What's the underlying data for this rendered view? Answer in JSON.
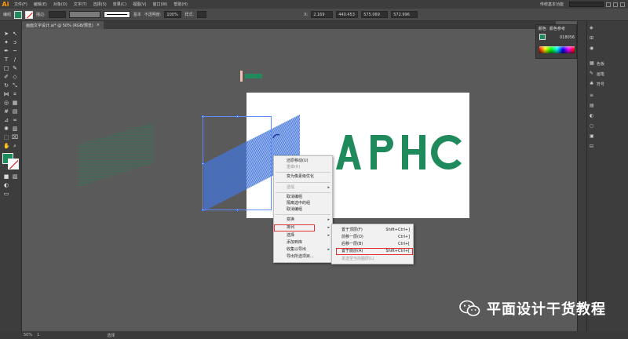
{
  "app": {
    "logo": "Ai"
  },
  "menu": [
    "文件(F)",
    "编辑(E)",
    "对象(O)",
    "文字(T)",
    "选择(S)",
    "效果(C)",
    "视图(V)",
    "窗口(W)",
    "帮助(H)"
  ],
  "workspace": "传统基本功能",
  "control": {
    "object_label": "编组",
    "opacity_label": "描边:",
    "stroke_style": "基本",
    "opacity_title": "不透明度:",
    "opacity_value": "100%",
    "style_label": "样式:",
    "x_value": "440.453",
    "y_value": "575.069",
    "w_value": "572.996",
    "ref_label": "X:",
    "mm_value": "2.169"
  },
  "document_tab": {
    "title": "画面文字设计.ai* @ 50% (RGB/预览)",
    "close": "×"
  },
  "status": {
    "zoom": "50%",
    "page": "1",
    "mode": "选择"
  },
  "color_panel": {
    "tab1": "颜色",
    "tab2": "颜色参考",
    "hex": "018056"
  },
  "dock": [
    {
      "icon": "swatch-icon",
      "label": "色板"
    },
    {
      "icon": "brush-icon",
      "label": "画笔"
    },
    {
      "icon": "symbol-icon",
      "label": "符号"
    }
  ],
  "artwork": {
    "letters": "APHC"
  },
  "context_menu": {
    "items": [
      {
        "label": "还原移动(U)",
        "disabled": false
      },
      {
        "label": "重做(R)",
        "disabled": true
      },
      {
        "label": "变为像素级优化",
        "disabled": false
      },
      {
        "label": "透视",
        "disabled": true,
        "submenu": true
      },
      {
        "label": "取消编组",
        "disabled": false
      },
      {
        "label": "隔离选中的组",
        "disabled": false
      },
      {
        "label": "取消编组",
        "disabled": false
      },
      {
        "label": "变换",
        "disabled": false,
        "submenu": true
      },
      {
        "label": "排列",
        "disabled": false,
        "submenu": true
      },
      {
        "label": "选择",
        "disabled": false,
        "submenu": true
      },
      {
        "label": "添加到库",
        "disabled": false
      },
      {
        "label": "收集以导出",
        "disabled": false,
        "submenu": true
      },
      {
        "label": "导出所选项目...",
        "disabled": false
      }
    ]
  },
  "arrange_submenu": {
    "items": [
      {
        "label": "置于顶层(F)",
        "shortcut": "Shift+Ctrl+]",
        "disabled": false
      },
      {
        "label": "前移一层(O)",
        "shortcut": "Ctrl+]",
        "disabled": false
      },
      {
        "label": "后移一层(B)",
        "shortcut": "Ctrl+[",
        "disabled": false
      },
      {
        "label": "置于底层(A)",
        "shortcut": "Shift+Ctrl+[",
        "disabled": false
      },
      {
        "label": "发送至当前图层(L)",
        "shortcut": "",
        "disabled": true
      }
    ]
  },
  "watermark": {
    "text": "平面设计干货教程"
  },
  "colors": {
    "brand_green": "#1f8a5b",
    "selection_blue": "#3a6fe8",
    "highlight_red": "#e03030"
  }
}
